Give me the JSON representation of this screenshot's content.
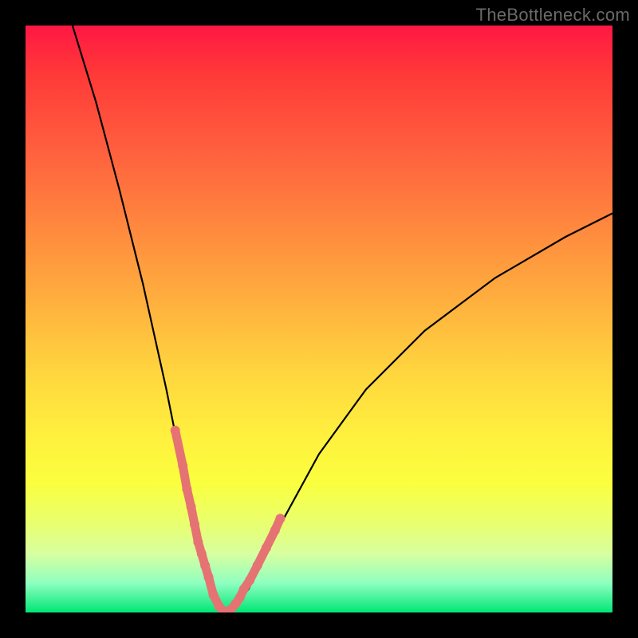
{
  "watermark": "TheBottleneck.com",
  "colors": {
    "background": "#000000",
    "gradient_top": "#ff1744",
    "gradient_mid": "#ffeb3b",
    "gradient_bottom": "#00e676",
    "curve": "#000000",
    "marker": "#e57373"
  },
  "chart_data": {
    "type": "line",
    "title": "",
    "xlabel": "",
    "ylabel": "",
    "xlim": [
      0,
      100
    ],
    "ylim": [
      0,
      100
    ],
    "series": [
      {
        "name": "bottleneck-curve",
        "x": [
          8,
          12,
          16,
          20,
          24,
          26,
          28,
          30,
          31,
          32,
          33,
          34,
          35,
          36,
          38,
          40,
          44,
          50,
          58,
          68,
          80,
          92,
          100
        ],
        "y": [
          100,
          87,
          72,
          56,
          38,
          28,
          18,
          10,
          6,
          3,
          1,
          0,
          0.5,
          1.5,
          4,
          8,
          16,
          27,
          38,
          48,
          57,
          64,
          68
        ]
      }
    ],
    "markers": {
      "name": "highlighted-points",
      "x": [
        25.5,
        26.8,
        27.5,
        28.2,
        28.8,
        29.4,
        30.0,
        30.6,
        31.2,
        32.0,
        33.0,
        34.0,
        35.0,
        35.8,
        36.5,
        37.2,
        38.2,
        39.5,
        41.0,
        42.5,
        43.4
      ],
      "y": [
        31,
        25,
        21,
        18,
        15,
        12,
        10,
        8,
        6,
        3,
        1,
        0,
        0.5,
        1.5,
        2.5,
        4,
        5.5,
        8,
        11,
        14,
        16
      ]
    }
  }
}
